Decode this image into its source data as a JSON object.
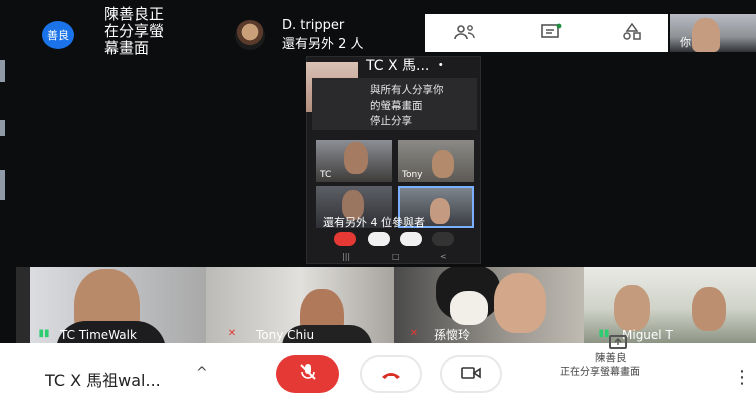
{
  "top": {
    "presenter_avatar": "善良",
    "presenter_lines": [
      "陳善良正",
      "在分享螢",
      "幕畫面"
    ],
    "tripper_name": "D. tripper",
    "tripper_sub": "還有另外 2 人",
    "self_label": "你"
  },
  "toolbar_icons": [
    "people-icon",
    "chat-icon",
    "activities-icon"
  ],
  "phone": {
    "title": "TC X 馬... ・",
    "banner_lines": [
      "與所有人分享你",
      "的螢幕畫面",
      "停止分享"
    ],
    "tiles": [
      "TC",
      "Tony",
      "",
      ""
    ],
    "note": "還有另外 4 位參與者"
  },
  "strip": [
    {
      "name": "TC TimeWalk",
      "muted": false
    },
    {
      "name": "Tony Chiu",
      "muted": true
    },
    {
      "name": "孫懷玲",
      "muted": true
    },
    {
      "name": "Miguel T",
      "muted": false
    }
  ],
  "bottom": {
    "meeting_title": "TC X 馬祖wal...",
    "chevron": "^",
    "presenter_name": "陳善良",
    "presenter_status": "正在分享螢幕畫面",
    "more": "⋮"
  },
  "colors": {
    "accent_blue": "#1a73e8",
    "mic_red": "#e53935",
    "hang_red": "#d93025",
    "dark_bg": "#0c0d0f"
  }
}
